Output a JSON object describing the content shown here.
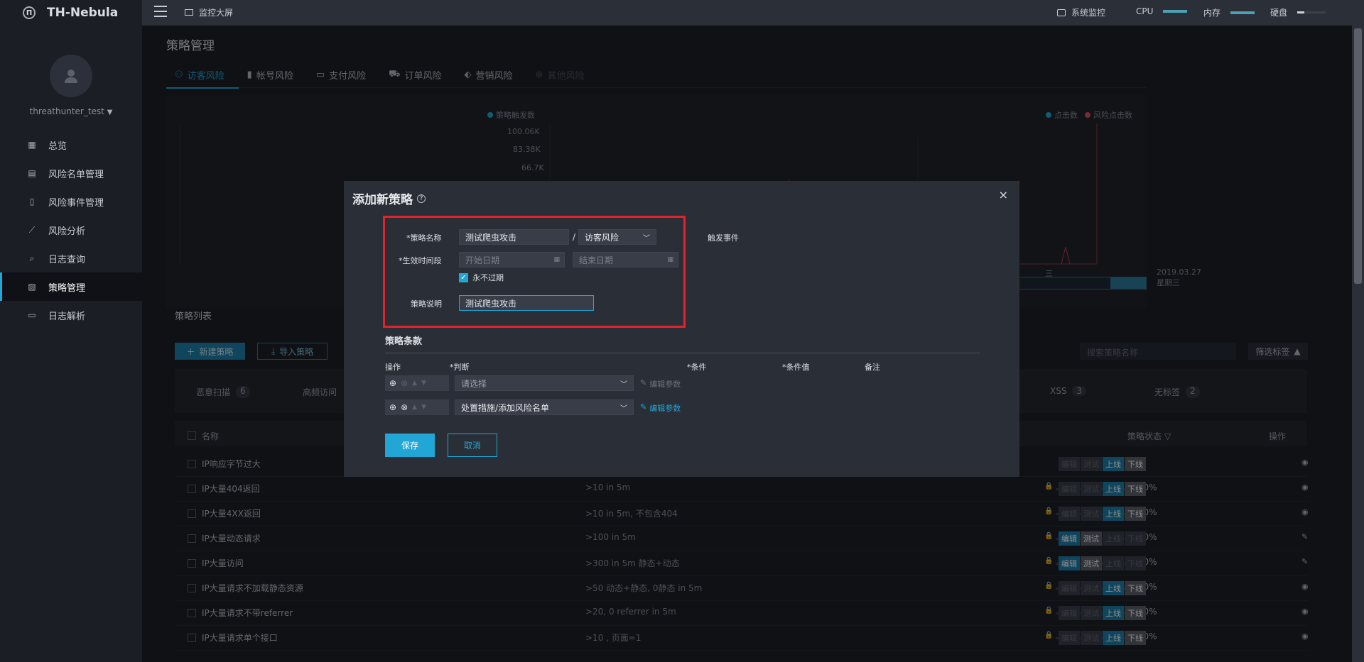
{
  "app": {
    "name": "TH-Nebula",
    "user": "threathunter_test"
  },
  "sidebar": {
    "items": [
      {
        "label": "总览",
        "icon": "grid-icon"
      },
      {
        "label": "风险名单管理",
        "icon": "list-card-icon"
      },
      {
        "label": "风险事件管理",
        "icon": "document-icon"
      },
      {
        "label": "风险分析",
        "icon": "line-chart-icon"
      },
      {
        "label": "日志查询",
        "icon": "search-icon"
      },
      {
        "label": "策略管理",
        "icon": "strategy-icon"
      },
      {
        "label": "日志解析",
        "icon": "file-icon"
      }
    ]
  },
  "topbar": {
    "monitor": "监控大屏",
    "system": "系统监控",
    "cpu": "CPU",
    "memory": "内存",
    "disk": "硬盘"
  },
  "page": {
    "title": "策略管理"
  },
  "tabs": [
    "访客风险",
    "帐号风险",
    "支付风险",
    "订单风险",
    "营销风险",
    "其他风险"
  ],
  "chart": {
    "legend_left": "策略触发数",
    "legend_right_1": "点击数",
    "legend_right_2": "风险点击数",
    "y_ticks": [
      "100.06K",
      "83.38K",
      "66.7K"
    ],
    "x_label": "2019.03.27 星期三",
    "x_label_partial": "三"
  },
  "list": {
    "title": "策略列表",
    "new_btn": "新建策略",
    "import_btn": "导入策略",
    "search_placeholder": "搜索策略名称",
    "filter_btn": "筛选标签",
    "tags": [
      {
        "name": "恶意扫描",
        "count": "6"
      },
      {
        "name": "高频访问",
        "count": ""
      },
      {
        "name": "XSS",
        "count": "3"
      },
      {
        "name": "无标签",
        "count": "2"
      }
    ],
    "col_name": "名称",
    "col_status": "策略状态",
    "col_op": "操作",
    "btn_edit": "编辑",
    "btn_test": "测试",
    "btn_online": "上线",
    "btn_offline": "下线",
    "rows": [
      {
        "name": "IP响应字节过大",
        "cond": "",
        "pct": "",
        "mode": "online"
      },
      {
        "name": "IP大量404返回",
        "cond": ">10 in 5m",
        "pct": "0.0%",
        "mode": "online"
      },
      {
        "name": "IP大量4XX返回",
        "cond": ">10 in 5m, 不包含404",
        "pct": "0.0%",
        "mode": "online"
      },
      {
        "name": "IP大量动态请求",
        "cond": ">100 in 5m",
        "pct": "0.0%",
        "mode": "editable"
      },
      {
        "name": "IP大量访问",
        "cond": ">300 in 5m 静态+动态",
        "pct": "0.0%",
        "mode": "editable"
      },
      {
        "name": "IP大量请求不加载静态资源",
        "cond": ">50 动态+静态, 0静态 in 5m",
        "pct": "0.0%",
        "mode": "online"
      },
      {
        "name": "IP大量请求不带referrer",
        "cond": ">20, 0 referrer in 5m",
        "pct": "0.0%",
        "mode": "online"
      },
      {
        "name": "IP大量请求单个接口",
        "cond": ">10 , 页面=1",
        "pct": "0.0%",
        "mode": "online"
      }
    ]
  },
  "modal": {
    "title": "添加新策略",
    "name_label": "*策略名称",
    "name_value": "测试爬虫攻击",
    "separator": "/",
    "category_value": "访客风险",
    "trigger_label": "触发事件",
    "period_label": "*生效时间段",
    "start_placeholder": "开始日期",
    "end_placeholder": "结束日期",
    "never_expire": "永不过期",
    "desc_label": "策略说明",
    "desc_value": "测试爬虫攻击",
    "section_title": "策略条款",
    "col_op": "操作",
    "col_judge": "*判断",
    "col_cond": "*条件",
    "col_value": "*条件值",
    "col_remark": "备注",
    "row1_select": "请选择",
    "row2_select": "处置措施/添加风险名单",
    "edit_params": "编辑参数",
    "save": "保存",
    "cancel": "取消"
  },
  "colors": {
    "accent": "#21a6d5",
    "highlight_border": "#e3232c"
  }
}
